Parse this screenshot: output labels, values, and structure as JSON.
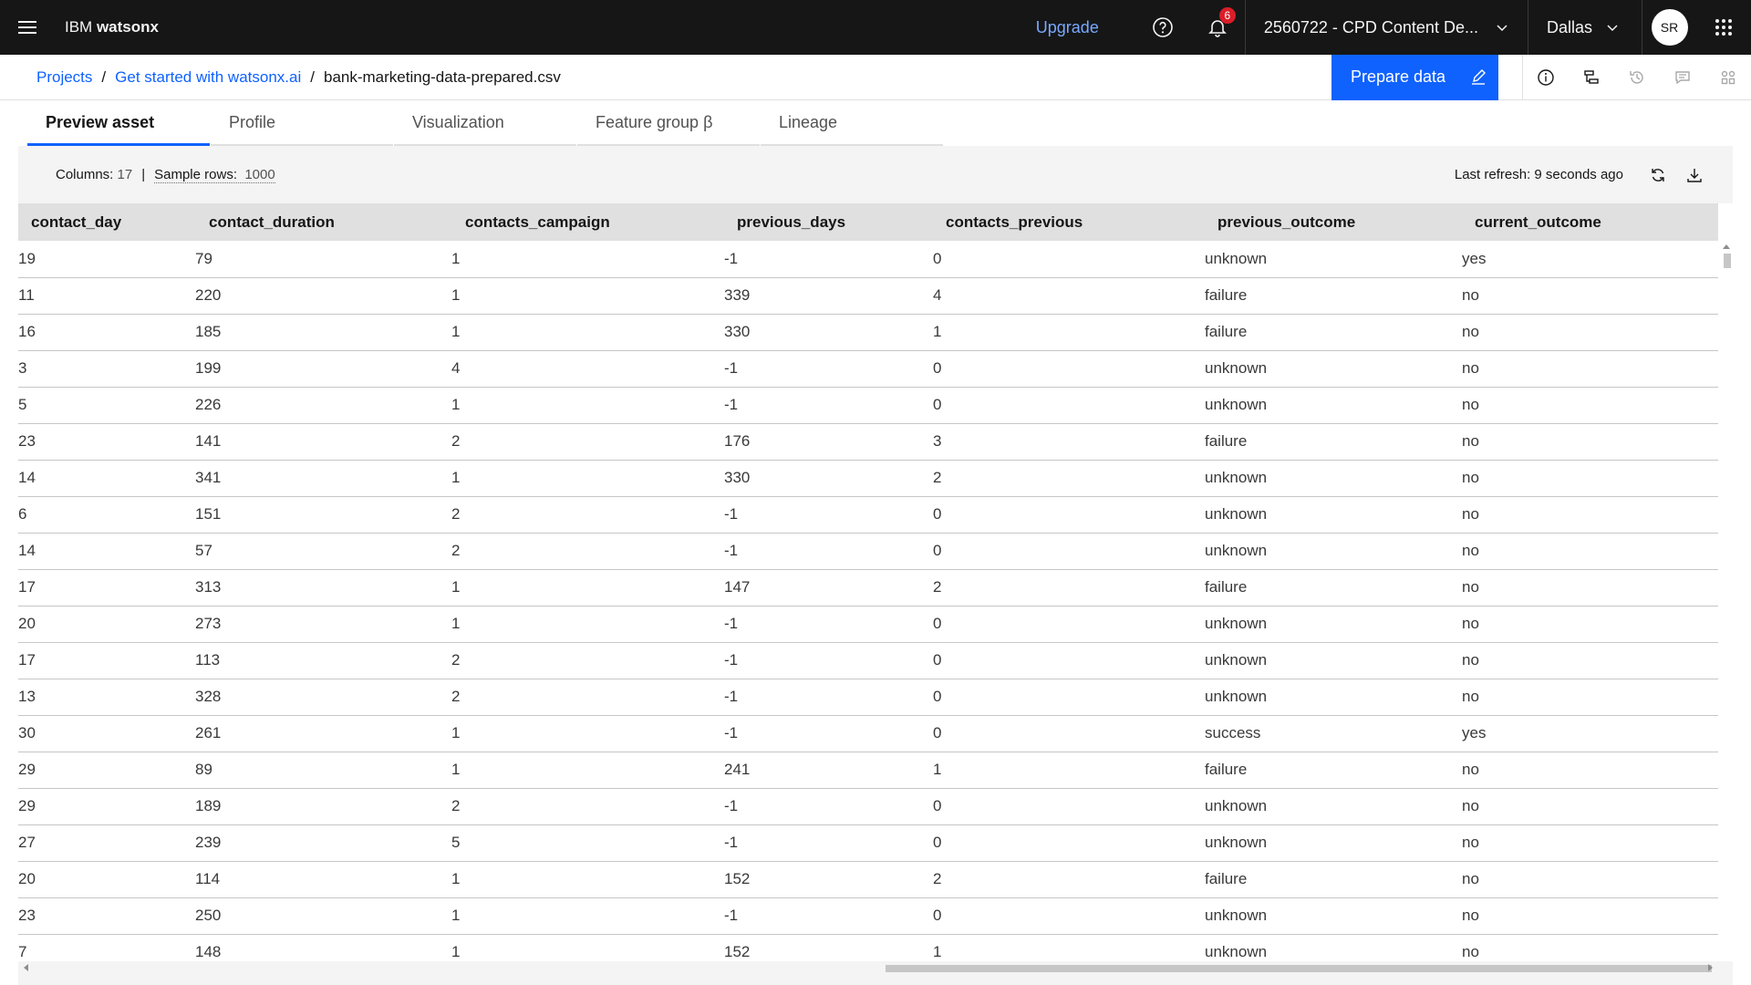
{
  "header": {
    "brand_prefix": "IBM ",
    "brand_name": "watsonx",
    "upgrade_label": "Upgrade",
    "notification_count": "6",
    "account_label": "2560722 - CPD Content De...",
    "region_label": "Dallas",
    "avatar_initials": "SR"
  },
  "breadcrumb": {
    "items": [
      "Projects",
      "Get started with watsonx.ai"
    ],
    "separator": "/",
    "current": "bank-marketing-data-prepared.csv"
  },
  "actions": {
    "prepare_label": "Prepare data"
  },
  "tabs": [
    {
      "label": "Preview asset",
      "active": true
    },
    {
      "label": "Profile",
      "active": false
    },
    {
      "label": "Visualization",
      "active": false
    },
    {
      "label": "Feature group β",
      "active": false
    },
    {
      "label": "Lineage",
      "active": false
    }
  ],
  "summary": {
    "columns_label": "Columns: ",
    "columns_value": "17",
    "pipe": "|",
    "sample_label": "Sample rows: ",
    "sample_value": "1000",
    "last_refresh": "Last refresh: 9 seconds ago"
  },
  "table": {
    "columns": [
      "contact_day",
      "contact_duration",
      "contacts_campaign",
      "previous_days",
      "contacts_previous",
      "previous_outcome",
      "current_outcome"
    ],
    "rows": [
      [
        "19",
        "79",
        "1",
        "-1",
        "0",
        "unknown",
        "yes"
      ],
      [
        "11",
        "220",
        "1",
        "339",
        "4",
        "failure",
        "no"
      ],
      [
        "16",
        "185",
        "1",
        "330",
        "1",
        "failure",
        "no"
      ],
      [
        "3",
        "199",
        "4",
        "-1",
        "0",
        "unknown",
        "no"
      ],
      [
        "5",
        "226",
        "1",
        "-1",
        "0",
        "unknown",
        "no"
      ],
      [
        "23",
        "141",
        "2",
        "176",
        "3",
        "failure",
        "no"
      ],
      [
        "14",
        "341",
        "1",
        "330",
        "2",
        "unknown",
        "no"
      ],
      [
        "6",
        "151",
        "2",
        "-1",
        "0",
        "unknown",
        "no"
      ],
      [
        "14",
        "57",
        "2",
        "-1",
        "0",
        "unknown",
        "no"
      ],
      [
        "17",
        "313",
        "1",
        "147",
        "2",
        "failure",
        "no"
      ],
      [
        "20",
        "273",
        "1",
        "-1",
        "0",
        "unknown",
        "no"
      ],
      [
        "17",
        "113",
        "2",
        "-1",
        "0",
        "unknown",
        "no"
      ],
      [
        "13",
        "328",
        "2",
        "-1",
        "0",
        "unknown",
        "no"
      ],
      [
        "30",
        "261",
        "1",
        "-1",
        "0",
        "success",
        "yes"
      ],
      [
        "29",
        "89",
        "1",
        "241",
        "1",
        "failure",
        "no"
      ],
      [
        "29",
        "189",
        "2",
        "-1",
        "0",
        "unknown",
        "no"
      ],
      [
        "27",
        "239",
        "5",
        "-1",
        "0",
        "unknown",
        "no"
      ],
      [
        "20",
        "114",
        "1",
        "152",
        "2",
        "failure",
        "no"
      ],
      [
        "23",
        "250",
        "1",
        "-1",
        "0",
        "unknown",
        "no"
      ],
      [
        "7",
        "148",
        "1",
        "152",
        "1",
        "unknown",
        "no"
      ]
    ]
  },
  "colors": {
    "topbar": "#161616",
    "accent": "#0f62fe",
    "upgrade": "#78a9ff",
    "badge": "#da1e28"
  }
}
